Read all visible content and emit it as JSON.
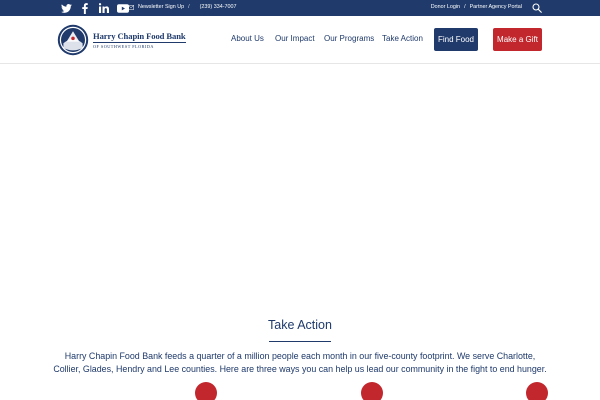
{
  "topbar": {
    "social_icons": [
      "twitter-icon",
      "facebook-icon",
      "linkedin-icon",
      "youtube-icon"
    ],
    "newsletter_label": "Newsletter Sign Up",
    "phone": "(239) 334-7007",
    "donor_login": "Donor Login",
    "partner_portal": "Partner Agency Portal",
    "search_icon": "search-icon"
  },
  "header": {
    "logo": {
      "name_line1": "Harry Chapin Food Bank",
      "name_line2": "OF SOUTHWEST FLORIDA"
    },
    "nav": [
      "About Us",
      "Our Impact",
      "Our Programs",
      "Take Action"
    ],
    "find_food": "Find Food",
    "make_gift": "Make a Gift"
  },
  "main": {
    "title": "Take Action",
    "intro": "Harry Chapin Food Bank feeds a quarter of a million people each month in our five-county footprint. We serve Charlotte, Collier, Glades, Hendry and Lee counties. Here are three ways you can help us lead our community in the fight to end hunger."
  },
  "colors": {
    "navy": "#1f3a6b",
    "red": "#c1272d"
  }
}
